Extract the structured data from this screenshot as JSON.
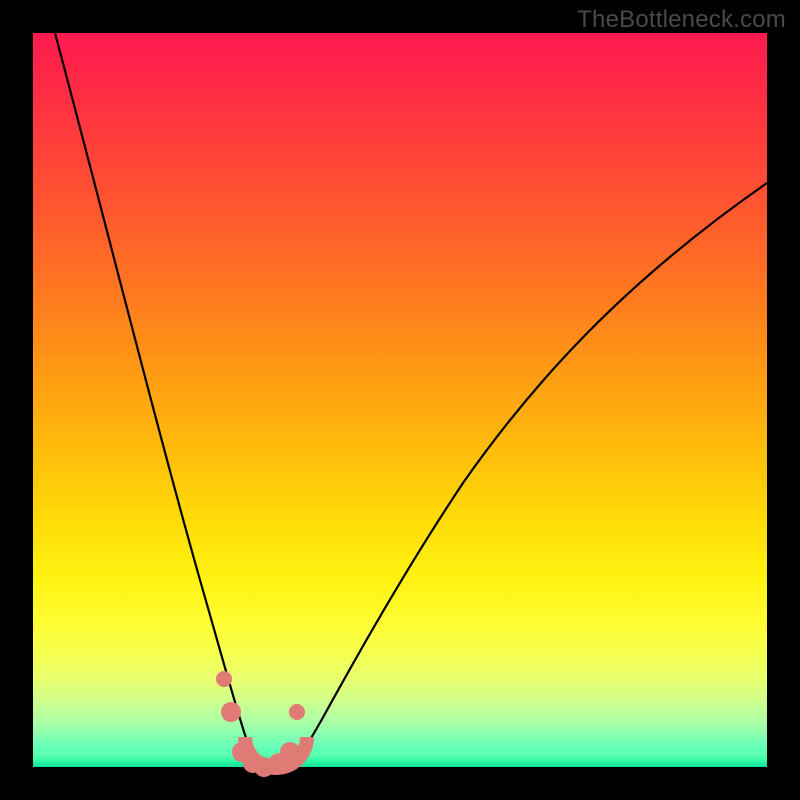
{
  "watermark": "TheBottleneck.com",
  "colors": {
    "frame_border": "#000000",
    "marker": "#DF7B74",
    "curve": "#000000",
    "gradient_top": "#FF1A4F",
    "gradient_mid": "#FFE84A",
    "gradient_bottom": "#2BFFB0"
  },
  "chart_data": {
    "type": "line",
    "title": "",
    "xlabel": "",
    "ylabel": "",
    "xlim": [
      0,
      100
    ],
    "ylim": [
      0,
      100
    ],
    "grid": false,
    "legend": false,
    "notes": "Axes have no labels or ticks. X represents component capability ratio (left=low, right=high). Y represents bottleneck percentage (top=100%, bottom=0%). Color gradient encodes Y: red=high bottleneck, green=low. Values are estimated from pixel heights.",
    "series": [
      {
        "name": "curve-left",
        "x": [
          3,
          6,
          9,
          12,
          15,
          18,
          20,
          22,
          24,
          26,
          27,
          28,
          29,
          30,
          31
        ],
        "y": [
          100,
          88,
          76,
          65,
          54,
          43,
          35,
          27,
          19,
          11,
          8,
          5,
          3,
          1,
          0
        ]
      },
      {
        "name": "curve-right",
        "x": [
          35,
          37,
          40,
          44,
          48,
          53,
          58,
          64,
          70,
          77,
          84,
          92,
          100
        ],
        "y": [
          0,
          3,
          8,
          15,
          23,
          31,
          39,
          47,
          55,
          62,
          69,
          75,
          80
        ]
      }
    ],
    "markers": [
      {
        "x": 26.0,
        "y": 12.0
      },
      {
        "x": 27.0,
        "y": 7.5
      },
      {
        "x": 28.5,
        "y": 2.0
      },
      {
        "x": 30.0,
        "y": 0.5
      },
      {
        "x": 31.5,
        "y": 0.0
      },
      {
        "x": 33.5,
        "y": 0.5
      },
      {
        "x": 35.0,
        "y": 2.0
      },
      {
        "x": 36.0,
        "y": 7.5
      }
    ],
    "u_band": {
      "x_start": 28.5,
      "x_end": 36.0,
      "y": 0
    }
  }
}
